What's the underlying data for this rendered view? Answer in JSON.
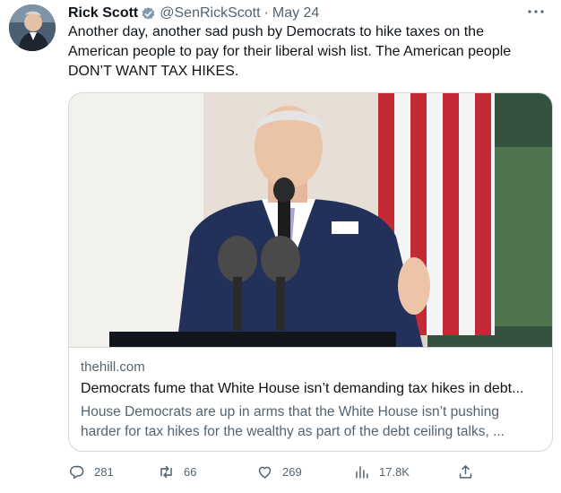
{
  "author": {
    "name": "Rick Scott",
    "handle": "@SenRickScott",
    "separator": "·",
    "date": "May 24",
    "verified": true,
    "avatar_icon": "profile-photo"
  },
  "tweet_text": "Another day, another sad push by Democrats to hike taxes on the American people to pay for their liberal wish list. The American people DON’T WANT TAX HIKES.",
  "card": {
    "image_icon": "podium-speech-photo",
    "domain": "thehill.com",
    "title": "Democrats fume that White House isn’t demanding tax hikes in debt...",
    "description": "House Democrats are up in arms that the White House isn’t pushing harder for tax hikes for the wealthy as part of the debt ceiling talks, ..."
  },
  "actions": {
    "replies": "281",
    "retweets": "66",
    "likes": "269",
    "views": "17.8K"
  },
  "colors": {
    "text": "#0f1419",
    "secondary": "#536471",
    "verified": "#829aab",
    "border": "#cfd9de"
  }
}
